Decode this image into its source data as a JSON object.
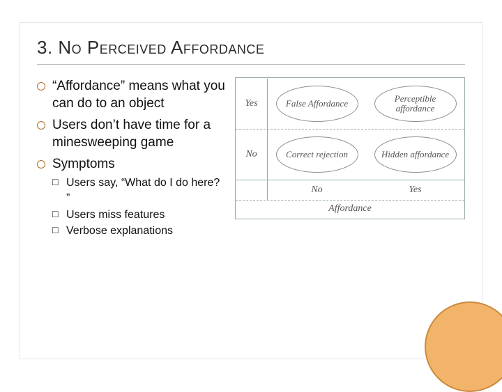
{
  "title": "3. No Perceived Affordance",
  "bullets": [
    "“Affordance” means what you can do to an object",
    "Users don’t have time for a minesweeping game",
    "Symptoms"
  ],
  "sub_bullets": [
    "Users say, “What do I do here? ”",
    "Users miss features",
    "Verbose explanations"
  ],
  "diagram": {
    "row_headers": [
      "Yes",
      "No"
    ],
    "col_footers": [
      "No",
      "Yes"
    ],
    "cells": {
      "top_left": "False Affordance",
      "top_right": "Perceptible affordance",
      "bottom_left": "Correct rejection",
      "bottom_right": "Hidden affordance"
    },
    "x_caption": "Affordance"
  }
}
